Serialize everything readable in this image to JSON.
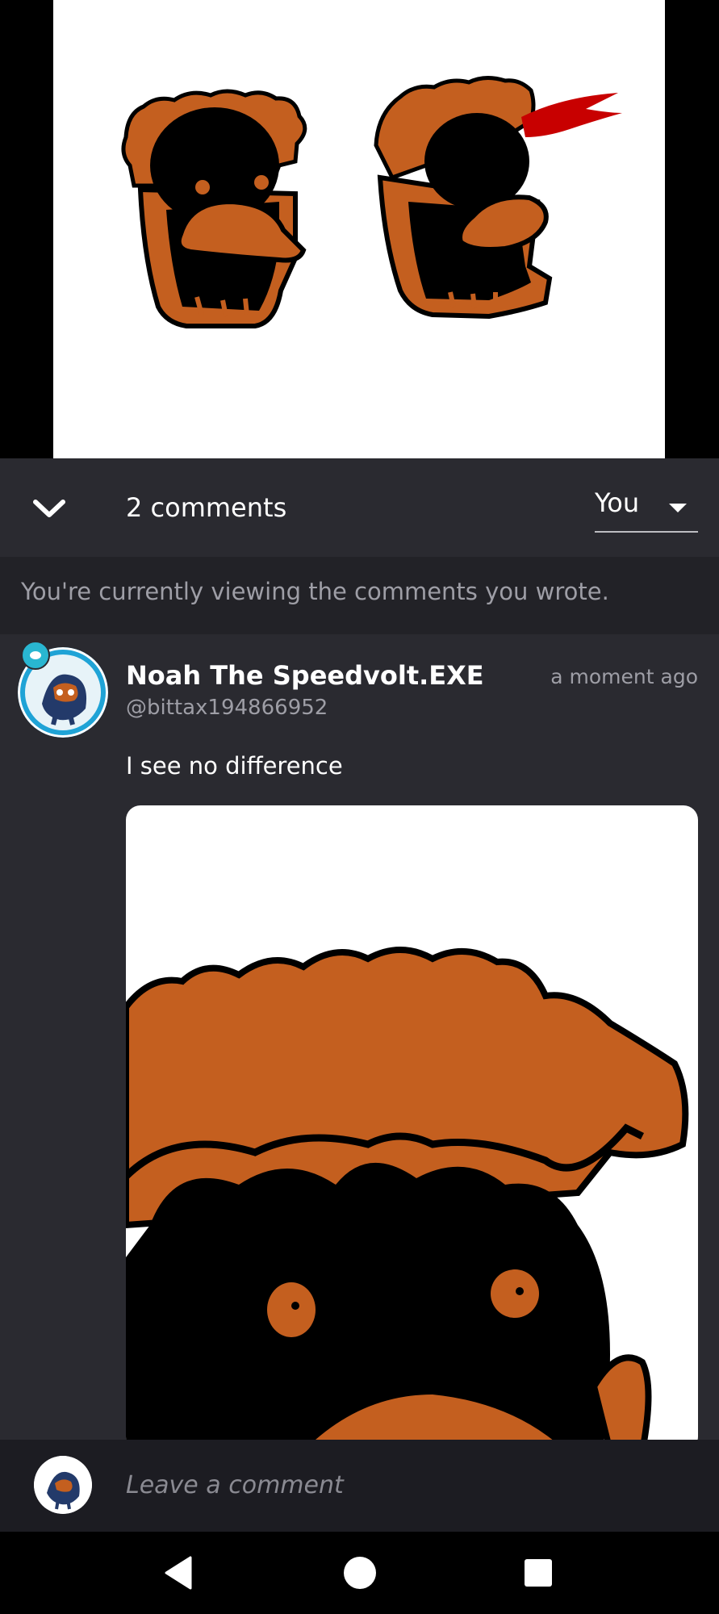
{
  "header": {
    "comment_count_label": "2 comments",
    "filter": {
      "selected": "You"
    }
  },
  "notice": {
    "text": "You're currently viewing the comments you wrote."
  },
  "comment": {
    "author": "Noah The Speedvolt.EXE",
    "handle": "@bittax194866952",
    "timestamp": "a moment ago",
    "text": "I see no difference"
  },
  "composer": {
    "placeholder": "Leave a comment"
  },
  "colors": {
    "panel": "#2a2a30",
    "notice_bg": "#222227",
    "input_bg": "#1c1c22",
    "text_primary": "#ffffff",
    "text_secondary": "#9e9ea6",
    "drawing_orange": "#c45f1f",
    "drawing_red": "#c80000"
  },
  "icons": {
    "collapse": "chevron-down-icon",
    "filter_caret": "caret-down-icon",
    "nav_back": "triangle-back-icon",
    "nav_home": "circle-home-icon",
    "nav_recent": "square-recent-icon"
  }
}
